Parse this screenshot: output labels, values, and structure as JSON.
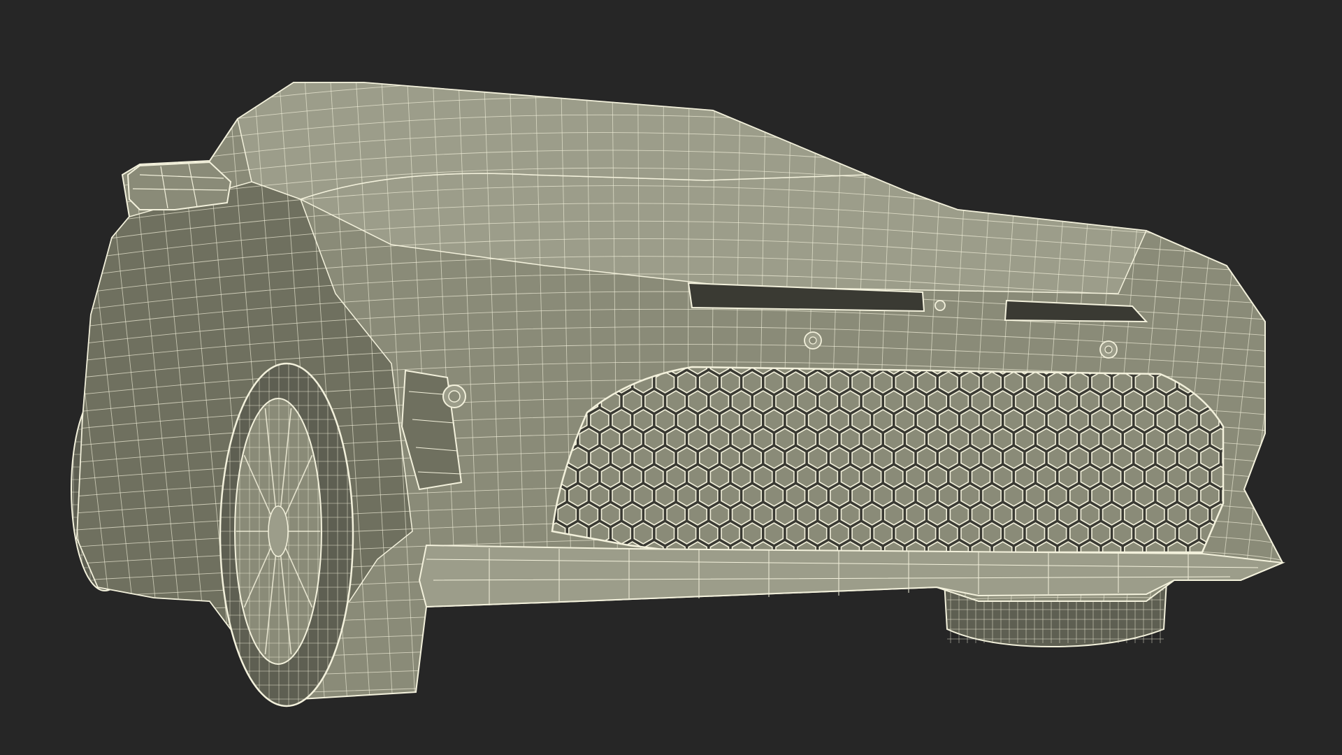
{
  "scene": {
    "subject": "wireframe-car-front",
    "render_mode": "wireframe-shaded"
  },
  "colors": {
    "background": "#262626",
    "surface": "#8a8b78",
    "surface_shadow": "#6f705f",
    "surface_light": "#9c9d8a",
    "wire": "#f3f1dc",
    "opening": "#3a3a33",
    "tire": "#5e5f52"
  },
  "icons": {
    "headlight": "headlight-icon",
    "fog_light": "fog-light-icon",
    "sensor": "sensor-icon",
    "wheel": "wheel-icon"
  }
}
